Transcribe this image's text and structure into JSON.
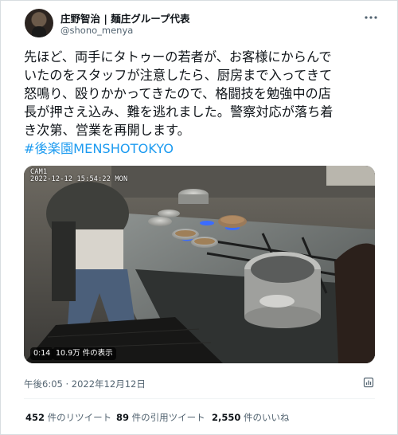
{
  "author": {
    "name": "庄野智治 | 麺庄グループ代表",
    "handle": "@shono_menya"
  },
  "tweet": {
    "lines": [
      "先ほど、両手にタトゥーの若者が、お客様にからんで",
      "いたのをスタッフが注意したら、厨房まで入ってきて",
      "怒鳴り、殴りかかってきたので、格闘技を勉強中の店",
      "長が押さえ込み、難を逃れました。警察対応が落ち着",
      "き次第、営業を再開します。"
    ],
    "hashtag": "#後楽園MENSHOTOKYO"
  },
  "media": {
    "camera_label": "CAM1",
    "camera_datetime": "2022-12-12  15:54:22  MON",
    "duration": "0:14",
    "views": "10.9万 件の表示"
  },
  "meta": {
    "timestamp": "午後6:05 · 2022年12月12日"
  },
  "stats": {
    "retweets_count": "452",
    "retweets_label": "件のリツイート",
    "quotes_count": "89",
    "quotes_label": "件の引用ツイート",
    "likes_count": "2,550",
    "likes_label": "件のいいね"
  },
  "icons": {
    "more": "more-options-icon",
    "analytics": "analytics-icon"
  },
  "colors": {
    "text": "#0f1419",
    "secondary": "#536471",
    "hashtag": "#1d9bf0",
    "border": "#d8dde1"
  }
}
